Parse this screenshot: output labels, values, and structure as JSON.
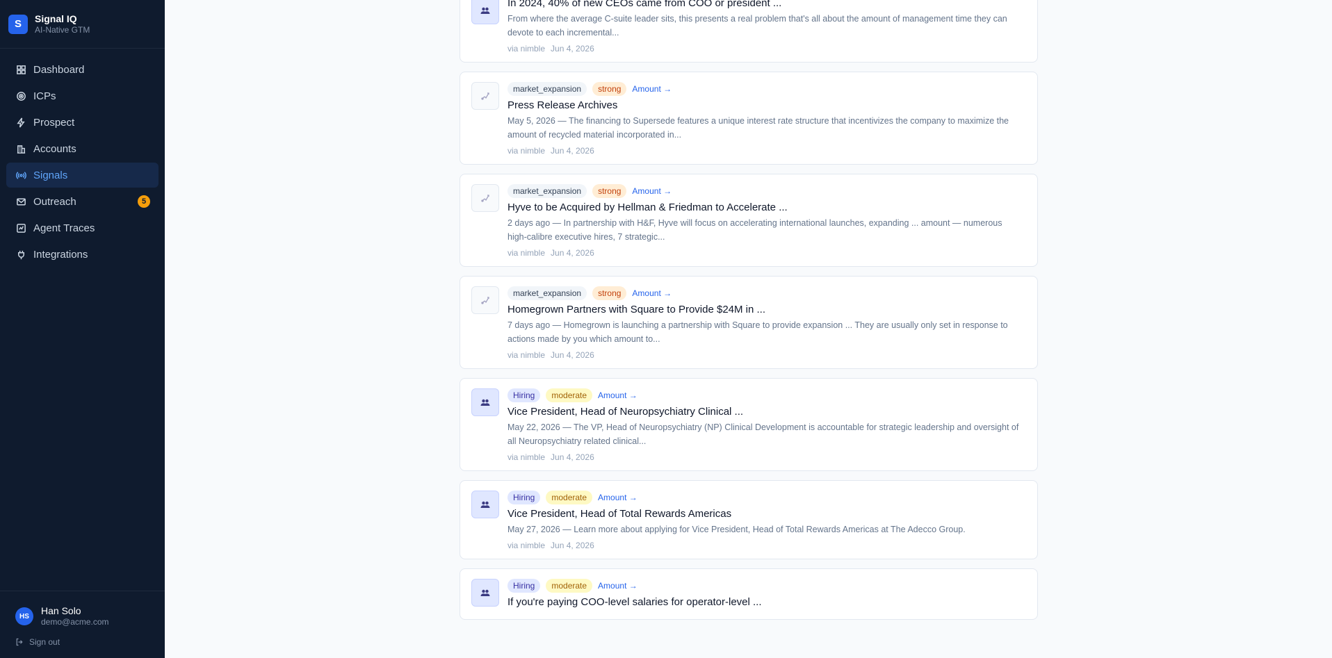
{
  "brand": {
    "logo": "S",
    "name": "Signal IQ",
    "subtitle": "AI-Native GTM"
  },
  "nav": [
    {
      "label": "Dashboard",
      "icon": "grid-icon"
    },
    {
      "label": "ICPs",
      "icon": "target-icon"
    },
    {
      "label": "Prospect",
      "icon": "bolt-icon"
    },
    {
      "label": "Accounts",
      "icon": "building-icon"
    },
    {
      "label": "Signals",
      "icon": "broadcast-icon",
      "active": true
    },
    {
      "label": "Outreach",
      "icon": "mail-icon",
      "badge": "5"
    },
    {
      "label": "Agent Traces",
      "icon": "trace-icon"
    },
    {
      "label": "Integrations",
      "icon": "plug-icon"
    }
  ],
  "user": {
    "initials": "HS",
    "name": "Han Solo",
    "email": "demo@acme.com",
    "signout": "Sign out"
  },
  "signals": [
    {
      "category": "",
      "strength": "",
      "amount": "",
      "title": "In 2024, 40% of new CEOs came from COO or president ...",
      "snippet": "From where the average C-suite leader sits, this presents a real problem that's all about the amount of management time they can devote to each incremental...",
      "via": "via nimble",
      "date": "Jun 4, 2026",
      "kind": "people"
    },
    {
      "category": "market_expansion",
      "strength": "strong",
      "amount": "Amount →",
      "title": "Press Release Archives",
      "snippet": "May 5, 2026 — The financing to Supersede features a unique interest rate structure that incentivizes the company to maximize the amount of recycled material incorporated in...",
      "via": "via nimble",
      "date": "Jun 4, 2026",
      "kind": "expansion"
    },
    {
      "category": "market_expansion",
      "strength": "strong",
      "amount": "Amount →",
      "title": "Hyve to be Acquired by Hellman & Friedman to Accelerate ...",
      "snippet": "2 days ago — In partnership with H&F, Hyve will focus on accelerating international launches, expanding ... amount — numerous high-calibre executive hires, 7 strategic...",
      "via": "via nimble",
      "date": "Jun 4, 2026",
      "kind": "expansion"
    },
    {
      "category": "market_expansion",
      "strength": "strong",
      "amount": "Amount →",
      "title": "Homegrown Partners with Square to Provide $24M in ...",
      "snippet": "7 days ago — Homegrown is launching a partnership with Square to provide expansion ... They are usually only set in response to actions made by you which amount to...",
      "via": "via nimble",
      "date": "Jun 4, 2026",
      "kind": "expansion"
    },
    {
      "category": "Hiring",
      "strength": "moderate",
      "amount": "Amount →",
      "title": "Vice President, Head of Neuropsychiatry Clinical ...",
      "snippet": "May 22, 2026 — The VP, Head of Neuropsychiatry (NP) Clinical Development is accountable for strategic leadership and oversight of all Neuropsychiatry related clinical...",
      "via": "via nimble",
      "date": "Jun 4, 2026",
      "kind": "people"
    },
    {
      "category": "Hiring",
      "strength": "moderate",
      "amount": "Amount →",
      "title": "Vice President, Head of Total Rewards Americas",
      "snippet": "May 27, 2026 — Learn more about applying for Vice President, Head of Total Rewards Americas at The Adecco Group.",
      "via": "via nimble",
      "date": "Jun 4, 2026",
      "kind": "people"
    },
    {
      "category": "Hiring",
      "strength": "moderate",
      "amount": "Amount →",
      "title": "If you're paying COO-level salaries for operator-level ...",
      "snippet": "",
      "via": "",
      "date": "",
      "kind": "people"
    }
  ]
}
